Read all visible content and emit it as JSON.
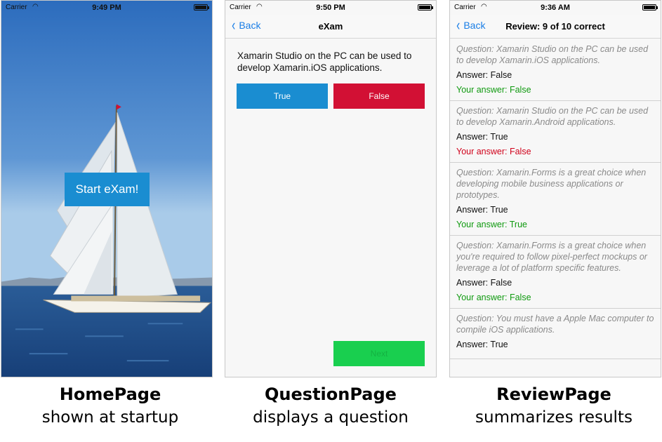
{
  "home": {
    "status": {
      "carrier": "Carrier",
      "time": "9:49 PM"
    },
    "start_button": "Start eXam!",
    "colors": {
      "sky_top": "#2f70bf",
      "sky_bottom": "#9cc3e6",
      "sea": "#1d4f8f",
      "button": "#1a8dd1"
    }
  },
  "question_page": {
    "status": {
      "carrier": "Carrier",
      "time": "9:50 PM"
    },
    "nav": {
      "back": "Back",
      "title": "eXam"
    },
    "question": "Xamarin Studio on the PC can be used to develop Xamarin.iOS applications.",
    "true_label": "True",
    "false_label": "False",
    "next_label": "Next",
    "colors": {
      "true": "#1a8dd1",
      "false": "#d21034",
      "next": "#19cf4f"
    }
  },
  "review_page": {
    "status": {
      "carrier": "Carrier",
      "time": "9:36 AM"
    },
    "nav": {
      "back": "Back",
      "title": "Review: 9 of 10 correct"
    },
    "items": [
      {
        "question": "Question: Xamarin Studio on the PC can be used to develop Xamarin.iOS applications.",
        "answer": "Answer: False",
        "your_answer": "Your answer: False",
        "correct": true
      },
      {
        "question": "Question: Xamarin Studio on the PC can be used to develop Xamarin.Android applications.",
        "answer": "Answer: True",
        "your_answer": "Your answer: False",
        "correct": false
      },
      {
        "question": "Question: Xamarin.Forms is a great choice when developing mobile business applications or prototypes.",
        "answer": "Answer: True",
        "your_answer": "Your answer: True",
        "correct": true
      },
      {
        "question": "Question: Xamarin.Forms is a great choice when you're required to follow pixel-perfect mockups or leverage a lot of platform specific features.",
        "answer": "Answer: False",
        "your_answer": "Your answer: False",
        "correct": true
      },
      {
        "question": "Question: You must have a Apple Mac computer to compile iOS applications.",
        "answer": "Answer: True",
        "your_answer": "",
        "correct": true
      }
    ],
    "colors": {
      "correct": "#109a10",
      "wrong": "#d0021b"
    }
  },
  "captions": [
    {
      "title": "HomePage",
      "subtitle": "shown at startup"
    },
    {
      "title": "QuestionPage",
      "subtitle": "displays a question"
    },
    {
      "title": "ReviewPage",
      "subtitle": "summarizes results"
    }
  ]
}
